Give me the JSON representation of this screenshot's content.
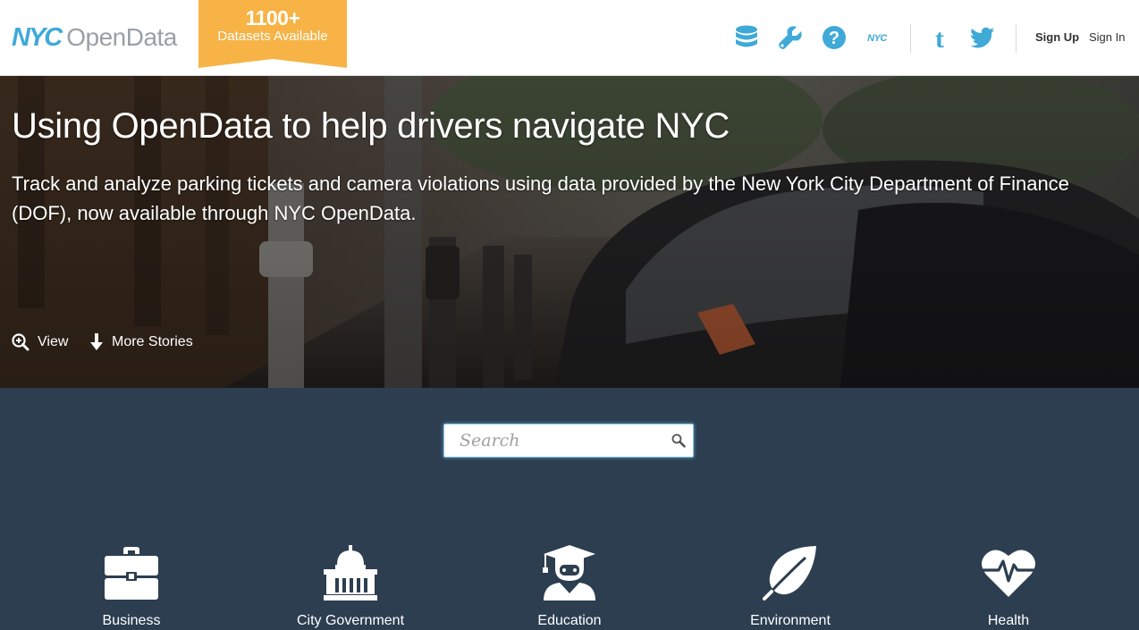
{
  "header": {
    "logo": {
      "nyc": "NYC",
      "opendata": "OpenData"
    },
    "ribbon": {
      "count": "1100+",
      "label": "Datasets Available"
    },
    "icons": [
      "database-icon",
      "wrench-icon",
      "help-icon",
      "nyc-icon",
      "tumblr-icon",
      "twitter-icon"
    ],
    "sign_up": "Sign Up",
    "sign_in": "Sign In"
  },
  "hero": {
    "title": "Using OpenData to help drivers navigate NYC",
    "description": "Track and analyze parking tickets and camera violations using data provided by the New York City Department of Finance (DOF), now available through NYC OpenData.",
    "view_label": "View",
    "more_label": "More Stories"
  },
  "search": {
    "placeholder": "Search"
  },
  "categories": [
    {
      "label": "Business",
      "icon": "briefcase-icon"
    },
    {
      "label": "City Government",
      "icon": "capitol-building-icon"
    },
    {
      "label": "Education",
      "icon": "graduate-icon"
    },
    {
      "label": "Environment",
      "icon": "leaf-icon"
    },
    {
      "label": "Health",
      "icon": "heart-pulse-icon"
    }
  ],
  "colors": {
    "accent": "#3fa9d8",
    "ribbon": "#f7b346",
    "panel": "#2c3e50"
  }
}
